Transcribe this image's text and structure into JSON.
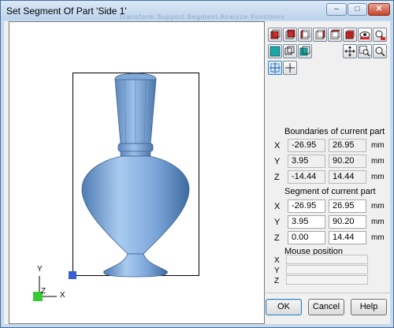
{
  "window": {
    "title": "Set Segment Of Part 'Side 1'",
    "ghost_tabs": "Transform   Support   Segment   Analyze   Functions",
    "controls": {
      "minimize": "–",
      "maximize": "□",
      "close": "✕"
    }
  },
  "viewport": {
    "axis_labels": {
      "x": "X",
      "y": "Y",
      "z": "Z"
    }
  },
  "toolbar": {
    "row1": [
      "view-front-icon",
      "view-back-icon",
      "view-left-icon",
      "view-right-icon",
      "view-top-icon",
      "view-bottom-icon",
      "eye-icon",
      "zoom-extents-icon"
    ],
    "row2": [
      "solid-shading-icon",
      "wireframe-icon",
      "shaded-edges-icon",
      "pan-icon",
      "zoom-window-icon",
      "zoom-icon"
    ],
    "row3": [
      "segment-select-icon",
      "crosshair-icon"
    ]
  },
  "boundaries": {
    "title": "Boundaries of current part",
    "rows": [
      {
        "axis": "X",
        "min": "-26.95",
        "max": "26.95",
        "unit": "mm"
      },
      {
        "axis": "Y",
        "min": "3.95",
        "max": "90.20",
        "unit": "mm"
      },
      {
        "axis": "Z",
        "min": "-14.44",
        "max": "14.44",
        "unit": "mm"
      }
    ]
  },
  "segment": {
    "title": "Segment of current part",
    "rows": [
      {
        "axis": "X",
        "min": "-26.95",
        "max": "26.95",
        "unit": "mm"
      },
      {
        "axis": "Y",
        "min": "3.95",
        "max": "90.20",
        "unit": "mm"
      },
      {
        "axis": "Z",
        "min": "0.00",
        "max": "14.44",
        "unit": "mm"
      }
    ]
  },
  "mouse": {
    "title": "Mouse position",
    "axes": [
      "X",
      "Y",
      "Z"
    ]
  },
  "buttons": {
    "ok": "OK",
    "cancel": "Cancel",
    "help": "Help"
  },
  "colors": {
    "vase": "#6f9bd0",
    "handle": "#3a5fd0",
    "axis_origin": "#33cc33"
  }
}
